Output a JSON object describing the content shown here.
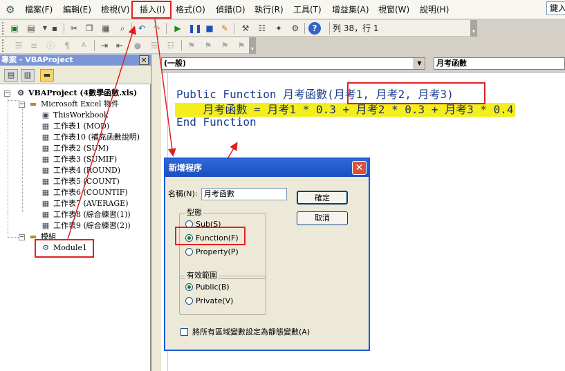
{
  "menubar": {
    "items": [
      "檔案(F)",
      "編輯(E)",
      "檢視(V)",
      "插入(I)",
      "格式(O)",
      "偵錯(D)",
      "執行(R)",
      "工具(T)",
      "增益集(A)",
      "視窗(W)",
      "說明(H)"
    ],
    "help_search_placeholder": "鍵入"
  },
  "toolbar": {
    "cursor_position": "列 38，行 1"
  },
  "project_pane": {
    "title": "專案 - VBAProject",
    "close": "×",
    "tree": {
      "project": "VBAProject (4數學函數.xls)",
      "excel_objects_folder": "Microsoft Excel 物件",
      "objects": [
        "ThisWorkbook",
        "工作表1 (MOD)",
        "工作表10 (補充函數說明)",
        "工作表2 (SUM)",
        "工作表3 (SUMIF)",
        "工作表4 (ROUND)",
        "工作表5 (COUNT)",
        "工作表6 (COUNTIF)",
        "工作表7 (AVERAGE)",
        "工作表8 (綜合練習(1))",
        "工作表9 (綜合練習(2))"
      ],
      "modules_folder": "模組",
      "modules": [
        "Module1"
      ]
    }
  },
  "code_window": {
    "object_combo": "(一般)",
    "procedure_combo": "月考函數",
    "lines": [
      "Public Function 月考函數(月考1, 月考2, 月考3)",
      "    月考函數 = 月考1 * 0.3 + 月考2 * 0.3 + 月考3 * 0.4",
      "End Function"
    ]
  },
  "dialog": {
    "title": "新增程序",
    "close": "✕",
    "name_label": "名稱(N):",
    "name_value": "月考函數",
    "ok": "確定",
    "cancel": "取消",
    "type_group": "型態",
    "type_options": [
      "Sub(S)",
      "Function(F)",
      "Property(P)"
    ],
    "type_selected": "Function(F)",
    "scope_group": "有效範圍",
    "scope_options": [
      "Public(B)",
      "Private(V)"
    ],
    "scope_selected": "Public(B)",
    "static_checkbox": "將所有區域變數設定為靜態變數(A)",
    "static_checked": false
  },
  "colors": {
    "highlight": "#f4ef1c",
    "annotation": "#e02020",
    "dialog_titlebar": "#1c4fbd",
    "code_text": "#1a3b8f"
  }
}
